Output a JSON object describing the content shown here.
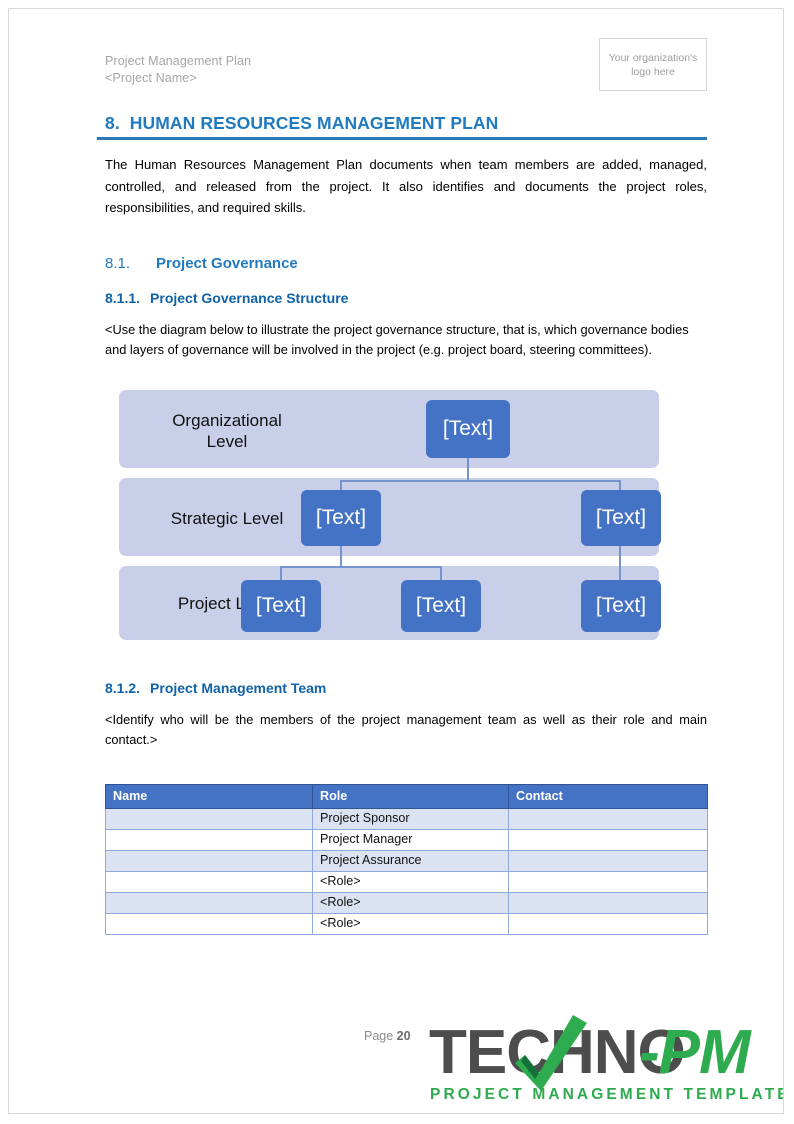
{
  "header": {
    "line1": "Project Management Plan",
    "line2": "<Project Name>",
    "logo_placeholder": "Your organization's logo here"
  },
  "section": {
    "number": "8.",
    "title": "HUMAN RESOURCES MANAGEMENT PLAN",
    "intro": "The Human Resources Management Plan documents when team members are added, managed, controlled, and released from the project. It also identifies and documents the project roles, responsibilities, and required skills."
  },
  "subsection_8_1": {
    "number": "8.1.",
    "title": "Project Governance"
  },
  "subsection_8_1_1": {
    "number": "8.1.1.",
    "title": "Project Governance Structure",
    "instruction": "<Use the diagram below to illustrate the project governance structure, that is, which governance bodies and layers of governance will be involved in the project (e.g. project board, steering committees)."
  },
  "diagram": {
    "band_color": "#c9cfe8",
    "node_color": "#4472c4",
    "connector_color": "#7593cd",
    "levels": [
      {
        "label": "Organizational\nLevel",
        "nodes": [
          "[Text]"
        ]
      },
      {
        "label": "Strategic Level",
        "nodes": [
          "[Text]",
          "[Text]"
        ]
      },
      {
        "label": "Project Level",
        "nodes": [
          "[Text]",
          "[Text]",
          "[Text]"
        ]
      }
    ]
  },
  "subsection_8_1_2": {
    "number": "8.1.2.",
    "title": "Project Management Team",
    "instruction": "<Identify who will be the members of the project management team as well as their role and main contact.>"
  },
  "team_table": {
    "header_bg": "#4472c4",
    "columns": [
      "Name",
      "Role",
      "Contact"
    ],
    "rows": [
      {
        "name": "",
        "role": "Project Sponsor",
        "contact": ""
      },
      {
        "name": "",
        "role": "Project Manager",
        "contact": ""
      },
      {
        "name": "",
        "role": "Project Assurance",
        "contact": ""
      },
      {
        "name": "",
        "role": "<Role>",
        "contact": ""
      },
      {
        "name": "",
        "role": "<Role>",
        "contact": ""
      },
      {
        "name": "",
        "role": "<Role>",
        "contact": ""
      }
    ]
  },
  "footer": {
    "page_label": "Page ",
    "page_number": "20",
    "brand_part1": "TECHNO",
    "brand_part2": "-PM",
    "brand_tagline": "PROJECT MANAGEMENT TEMPLATES",
    "brand_gray": "#4d4d4d",
    "brand_green": "#2eab4f"
  }
}
